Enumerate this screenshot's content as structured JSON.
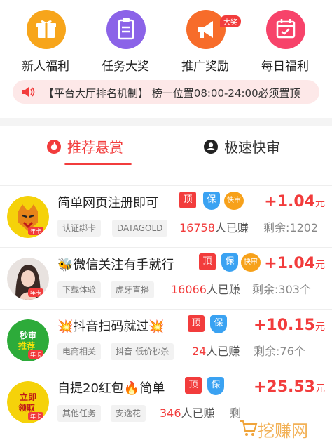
{
  "quick_actions": [
    {
      "label": "新人福利",
      "icon": "gift-icon",
      "color": "#f7a51b"
    },
    {
      "label": "任务大奖",
      "icon": "clipboard-icon",
      "color": "#8b63e8"
    },
    {
      "label": "推广奖励",
      "icon": "megaphone-icon",
      "color": "#f76c2a",
      "badge": "大奖"
    },
    {
      "label": "每日福利",
      "icon": "calendar-check-icon",
      "color": "#f7436a"
    }
  ],
  "notice": {
    "text": "【平台大厅排名机制】 榜一位置08:00-24:00必须置顶"
  },
  "tabs": [
    {
      "label": "推荐悬赏",
      "icon": "flame-icon",
      "active": true
    },
    {
      "label": "极速快审",
      "icon": "user-icon",
      "active": false
    }
  ],
  "tags": {
    "top": "顶",
    "bao": "保",
    "fast": "快审"
  },
  "tasks": [
    {
      "title": "简单网页注册即可",
      "reward": "+1.04",
      "unit": "元",
      "chips": [
        "认证绑卡",
        "DATAGOLD"
      ],
      "earned_num": "16758",
      "earned_suffix": "人已赚",
      "remain": "剩余:1202",
      "avatar_tag": "年卡"
    },
    {
      "title": "🐝微信关注有手就行",
      "reward": "+1.04",
      "unit": "元",
      "chips": [
        "下载体验",
        "虎牙直播"
      ],
      "earned_num": "16066",
      "earned_suffix": "人已赚",
      "remain": "剩余:303个",
      "avatar_tag": "年卡"
    },
    {
      "title": "💥抖音扫码就过💥",
      "reward": "+10.15",
      "unit": "元",
      "chips": [
        "电商相关",
        "抖音-低价秒杀"
      ],
      "earned_num": "24",
      "earned_suffix": "人已赚",
      "remain": "剩余:76个",
      "avatar_text": "秒审推荐",
      "avatar_tag": "年卡"
    },
    {
      "title": "自提20红包🔥简单",
      "reward": "+25.53",
      "unit": "元",
      "chips": [
        "其他任务",
        "安逸花"
      ],
      "earned_num": "346",
      "earned_suffix": "人已赚",
      "remain": "剩",
      "avatar_text": "立即领取",
      "avatar_tag": "年卡"
    }
  ],
  "watermark": {
    "text": "挖赚网"
  }
}
